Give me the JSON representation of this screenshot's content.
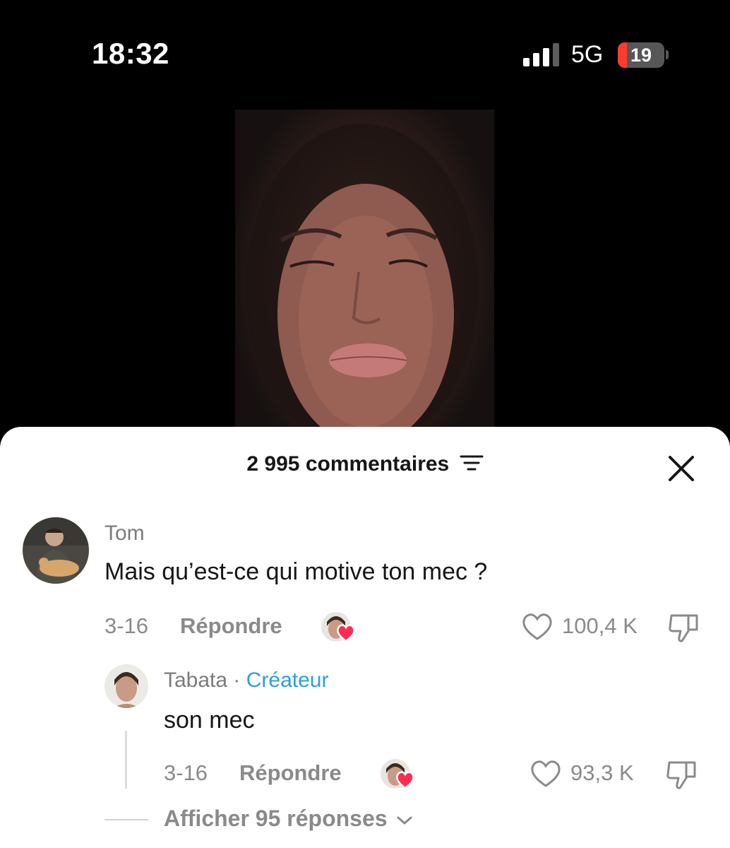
{
  "status_bar": {
    "time": "18:32",
    "network": "5G",
    "battery": "19",
    "battery_level": 0.19,
    "signal_bars": 3
  },
  "video": {
    "description_icon": "video-frame"
  },
  "comments_panel": {
    "count_label": "2 995 commentaires",
    "sort_icon": "filter-icon",
    "close_icon": "close-icon",
    "comments": [
      {
        "username": "Tom",
        "text": "Mais qu’est-ce qui motive ton mec ?",
        "date": "3-16",
        "reply_label": "Répondre",
        "likes": "100,4 K"
      }
    ],
    "reply": {
      "username": "Tabata",
      "separator": " · ",
      "badge": "Créateur",
      "text": "son mec",
      "date": "3-16",
      "reply_label": "Répondre",
      "likes": "93,3 K"
    },
    "more_replies": "Afficher 95 réponses"
  },
  "colors": {
    "accent_blue": "#2aa0d8",
    "heart_red": "#fe2c55",
    "battery_red": "#ff3b30"
  }
}
